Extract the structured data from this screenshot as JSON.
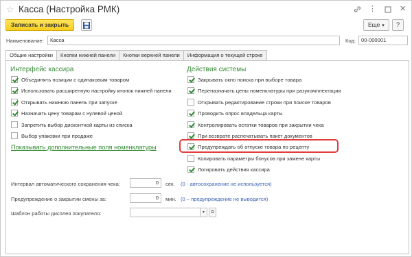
{
  "window": {
    "title": "Касса (Настройка РМК)"
  },
  "toolbar": {
    "save_close_label": "Записать и закрыть",
    "more_label": "Еще",
    "help_label": "?"
  },
  "header": {
    "name_label": "Наименование:",
    "name_value": "Касса",
    "code_label": "Код:",
    "code_value": "00-000001"
  },
  "tabs": [
    {
      "label": "Общие настройки",
      "active": true
    },
    {
      "label": "Кнопки нижней панели",
      "active": false
    },
    {
      "label": "Кнопки верхней панели",
      "active": false
    },
    {
      "label": "Информация о текущей строке",
      "active": false
    }
  ],
  "cashier": {
    "title": "Интерфейс кассира",
    "items": [
      {
        "label": "Объединять позиции с одинаковым товаром",
        "checked": true
      },
      {
        "label": "Использовать расширенную настройку кнопок нижней панели",
        "checked": true
      },
      {
        "label": "Открывать нижнюю панель при запуске",
        "checked": true
      },
      {
        "label": "Назначать цену товарам с нулевой ценой",
        "checked": true
      },
      {
        "label": "Запретить выбор дисконтной карты из списка",
        "checked": false
      },
      {
        "label": "Выбор упаковки при продаже",
        "checked": false
      }
    ],
    "link": "Показывать дополнительные поля номенклатуры"
  },
  "system": {
    "title": "Действия системы",
    "items": [
      {
        "label": "Закрывать окно поиска при выборе товара",
        "checked": true
      },
      {
        "label": "Переназначать цены номенклатуры при разукомплектации",
        "checked": true
      },
      {
        "label": "Открывать редактирование строки при поиске товаров",
        "checked": false
      },
      {
        "label": "Проводить опрос владельца карты",
        "checked": true
      },
      {
        "label": "Контролировать остатки товаров при закрытии чека",
        "checked": true
      },
      {
        "label": "При возврате распечатывать пакет документов",
        "checked": true
      },
      {
        "label": "Предупреждать об отпуске товара по рецепту",
        "checked": true
      },
      {
        "label": "Копировать параметры бонусов при замене карты",
        "checked": false
      },
      {
        "label": "Логировать действия кассира",
        "checked": true
      }
    ]
  },
  "settings": {
    "autosave_label": "Интервал автоматического сохранения чека:",
    "autosave_value": "0",
    "autosave_unit": "сек.",
    "autosave_hint": "(0 - автосохранение не используется)",
    "shift_label": "Предупреждение о закрытии смены за:",
    "shift_value": "0",
    "shift_unit": "мин.",
    "shift_hint": "(0 – предупреждение не выводится)",
    "display_label": "Шаблон работы дисплея покупателя:",
    "display_value": ""
  }
}
